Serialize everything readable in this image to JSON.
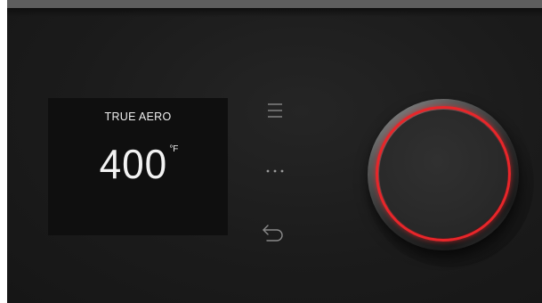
{
  "display": {
    "mode": "TRUE AERO",
    "temperature": "400",
    "unit": "°F"
  },
  "controls": {
    "menu_icon": "menu-icon",
    "more_icon": "more-options-icon",
    "back_icon": "back-arrow-icon"
  },
  "knob": {
    "ring_color": "#e8262a"
  },
  "colors": {
    "panel": "#1d1d1d",
    "display_bg": "#0f0f0f",
    "accent": "#e8262a"
  }
}
